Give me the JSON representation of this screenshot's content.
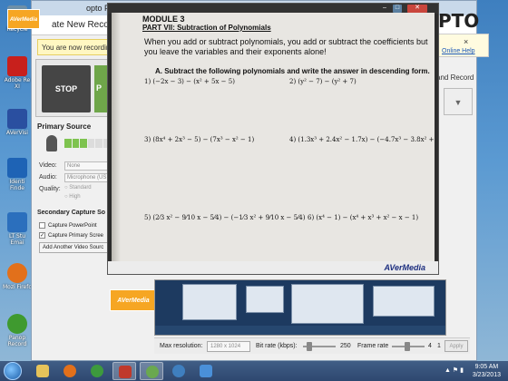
{
  "desktop": {
    "icons": [
      {
        "label": "Recycle",
        "color": "#6d8fa8"
      },
      {
        "label": "Adobe Re XI",
        "color": "#c8201c"
      },
      {
        "label": "AVerVisi",
        "color": "#2a4fa0"
      },
      {
        "label": "Identi Finde",
        "color": "#1e63b5"
      },
      {
        "label": "LT Stu Emai",
        "color": "#2b6fbd"
      },
      {
        "label": "Mozi Firefo",
        "color": "#e2701b"
      },
      {
        "label": "Panop Record",
        "color": "#3f9a2f"
      }
    ]
  },
  "panopto": {
    "title": "opto Focus",
    "recording_name": "ate New Recordin",
    "notice": "You are now recording.",
    "stop_label": "STOP",
    "pause_label": "P",
    "primary_source_label": "Primary Source",
    "video_label": "Video:",
    "video_value": "None",
    "audio_label": "Audio:",
    "audio_value": "Microphone (US",
    "quality_label": "Quality:",
    "quality_standard": "Standard",
    "quality_high": "High",
    "secondary_label": "Secondary Capture So",
    "capture_powerpoint": "Capture PowerPoint",
    "capture_primary_screen": "Capture Primary Scree",
    "add_video_label": "Add Another Video Sourc",
    "brand_partial": "PTO",
    "help_link": "Online Help",
    "help_close": "×",
    "upload_label": "and Record",
    "max_resolution_label": "Max resolution:",
    "max_resolution_value": "1280 x 1024",
    "bitrate_label": "Bit rate (kbps):",
    "bitrate_value": "250",
    "framerate_label": "Frame rate",
    "framerate_value": "4",
    "framerate_extra": "1",
    "apply_label": "Apply"
  },
  "aver_window": {
    "module_title": "MODULE 3",
    "part_title": "PART VII:  Subtraction of Polynomials",
    "intro": "When you add or subtract polynomials, you add or subtract the coefficients but you leave the variables and their exponents alone!",
    "section": "A.  Subtract the following polynomials and write the answer in descending form.",
    "problems": [
      "1)  (−2x − 3) − (x² + 5x − 5)",
      "2)  (y² − 7) − (y² + 7)",
      "3)  (8x⁴ + 2x³ − 5) − (7x³ − x² − 1)",
      "4)  (1.3x³ + 2.4x² − 1.7x) − (−4.7x³ − 3.8x² + 5.6)",
      "5)  (2⁄3 x² − 9⁄10 x − 5⁄4) − (−1⁄3 x² + 9⁄10 x − 5⁄4)",
      "6)  (x⁴ − 1) − (x⁴ + x³ + x² − x − 1)"
    ],
    "brand": "AVerMedia",
    "logo_small": "AVerMedia"
  },
  "taskbar": {
    "time": "9:05 AM",
    "date": "3/23/2013",
    "items": [
      {
        "name": "explorer",
        "color": "#e6c35a"
      },
      {
        "name": "firefox",
        "color": "#e2701b"
      },
      {
        "name": "chrome",
        "color": "#3d9a3d"
      },
      {
        "name": "aver",
        "color": "#c0392b"
      },
      {
        "name": "panopto",
        "color": "#6aa84f"
      },
      {
        "name": "player",
        "color": "#3f7fbf"
      },
      {
        "name": "paint",
        "color": "#4a90d9"
      }
    ]
  }
}
